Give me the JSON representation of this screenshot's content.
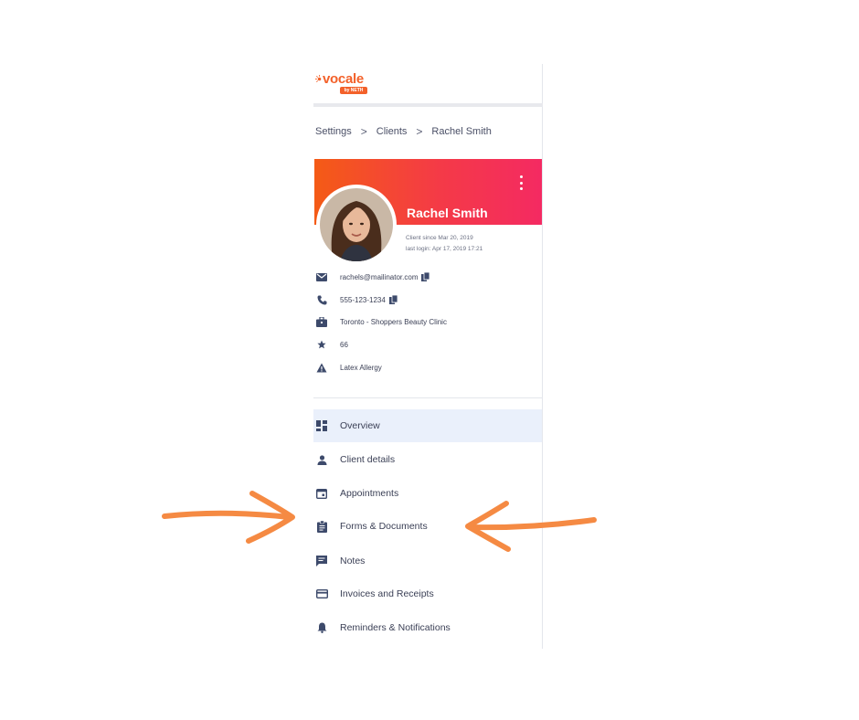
{
  "brand": {
    "name": "vocale",
    "badge": "by NETH"
  },
  "breadcrumb": [
    {
      "label": "Settings"
    },
    {
      "label": "Clients"
    },
    {
      "label": "Rachel Smith"
    }
  ],
  "breadcrumb_separator": ">",
  "client": {
    "name": "Rachel Smith",
    "client_since": "Client since Mar 20, 2019",
    "last_login": "last login: Apr 17, 2019 17:21",
    "email": "rachels@mailinator.com",
    "phone": "555-123-1234",
    "location": "Toronto - Shoppers Beauty Clinic",
    "points": "66",
    "alert": "Latex Allergy"
  },
  "nav": [
    {
      "label": "Overview",
      "icon": "dashboard-icon",
      "active": true
    },
    {
      "label": "Client details",
      "icon": "person-icon"
    },
    {
      "label": "Appointments",
      "icon": "calendar-icon"
    },
    {
      "label": "Forms & Documents",
      "icon": "clipboard-icon"
    },
    {
      "label": "Notes",
      "icon": "note-icon"
    },
    {
      "label": "Invoices and Receipts",
      "icon": "credit-card-icon"
    },
    {
      "label": "Reminders & Notifications",
      "icon": "bell-icon"
    }
  ],
  "colors": {
    "brand_orange": "#f3612a",
    "banner_start": "#f45b16",
    "banner_end": "#f42a62",
    "active_bg": "#eaf0fb",
    "icon": "#3d4a6b",
    "annotation_arrow": "#f58a43"
  }
}
